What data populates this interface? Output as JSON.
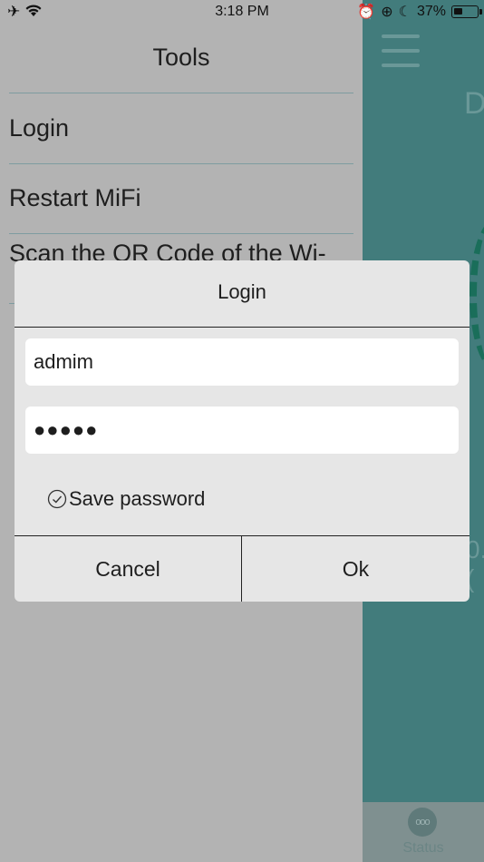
{
  "statusbar": {
    "time": "3:18 PM",
    "left_icons": "✈ ",
    "battery_percent": "37%",
    "battery_level": 0.37
  },
  "drawer": {
    "title": "Tools",
    "items": [
      {
        "label": "Login"
      },
      {
        "label": "Restart MiFi"
      },
      {
        "label": "Scan the QR Code of the Wi-"
      }
    ]
  },
  "background": {
    "tab_label": "Status"
  },
  "dialog": {
    "title": "Login",
    "username_value": "admim",
    "password_value": "●●●●●",
    "save_password_label": "Save password",
    "cancel_label": "Cancel",
    "ok_label": "Ok"
  },
  "colors": {
    "teal_background": "#427c7c",
    "overlay_gray": "#b3b3b3",
    "dialog_background": "#e6e6e6"
  }
}
